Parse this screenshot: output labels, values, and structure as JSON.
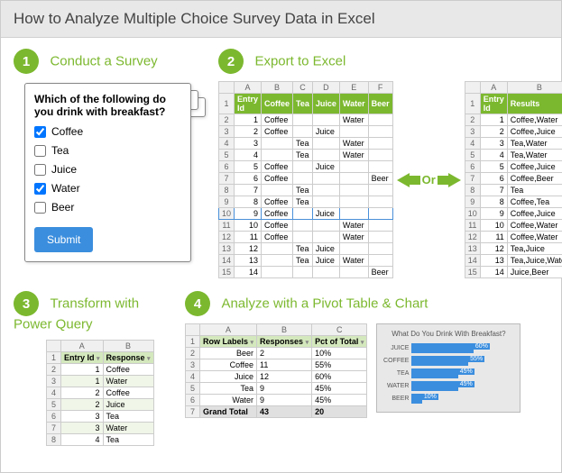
{
  "title": "How to Analyze Multiple Choice Survey Data in Excel",
  "steps": {
    "s1": {
      "num": "1",
      "title": "Conduct a Survey"
    },
    "s2": {
      "num": "2",
      "title": "Export to Excel"
    },
    "s3": {
      "num": "3",
      "title": "Transform with Power Query"
    },
    "s4": {
      "num": "4",
      "title": "Analyze with a Pivot Table & Chart"
    }
  },
  "survey": {
    "question": "Which of the following do you drink with breakfast?",
    "options": [
      "Coffee",
      "Tea",
      "Juice",
      "Water",
      "Beer"
    ],
    "checked": [
      true,
      false,
      false,
      true,
      false
    ],
    "submit": "Submit"
  },
  "or_label": "Or",
  "sheet_wide": {
    "cols": [
      "A",
      "B",
      "C",
      "D",
      "E",
      "F"
    ],
    "headers": [
      "Entry Id",
      "Coffee",
      "Tea",
      "Juice",
      "Water",
      "Beer"
    ],
    "rows": [
      [
        "1",
        "Coffee",
        "",
        "",
        "Water",
        ""
      ],
      [
        "2",
        "Coffee",
        "",
        "Juice",
        "",
        ""
      ],
      [
        "3",
        "",
        "Tea",
        "",
        "Water",
        ""
      ],
      [
        "4",
        "",
        "Tea",
        "",
        "Water",
        ""
      ],
      [
        "5",
        "Coffee",
        "",
        "Juice",
        "",
        ""
      ],
      [
        "6",
        "Coffee",
        "",
        "",
        "",
        "Beer"
      ],
      [
        "7",
        "",
        "Tea",
        "",
        "",
        ""
      ],
      [
        "8",
        "Coffee",
        "Tea",
        "",
        "",
        ""
      ],
      [
        "9",
        "Coffee",
        "",
        "Juice",
        "",
        ""
      ],
      [
        "10",
        "Coffee",
        "",
        "",
        "Water",
        ""
      ],
      [
        "11",
        "Coffee",
        "",
        "",
        "Water",
        ""
      ],
      [
        "12",
        "",
        "Tea",
        "Juice",
        "",
        ""
      ],
      [
        "13",
        "",
        "Tea",
        "Juice",
        "Water",
        ""
      ],
      [
        "14",
        "",
        "",
        "",
        "",
        "Beer"
      ]
    ]
  },
  "sheet_long": {
    "cols": [
      "A",
      "B"
    ],
    "headers": [
      "Entry Id",
      "Results"
    ],
    "rows": [
      [
        "1",
        "Coffee,Water"
      ],
      [
        "2",
        "Coffee,Juice"
      ],
      [
        "3",
        "Tea,Water"
      ],
      [
        "4",
        "Tea,Water"
      ],
      [
        "5",
        "Coffee,Juice"
      ],
      [
        "6",
        "Coffee,Beer"
      ],
      [
        "7",
        "Tea"
      ],
      [
        "8",
        "Coffee,Tea"
      ],
      [
        "9",
        "Coffee,Juice"
      ],
      [
        "10",
        "Coffee,Water"
      ],
      [
        "11",
        "Coffee,Water"
      ],
      [
        "12",
        "Tea,Juice"
      ],
      [
        "13",
        "Tea,Juice,Water"
      ],
      [
        "14",
        "Juice,Beer"
      ]
    ]
  },
  "pq": {
    "cols": [
      "A",
      "B"
    ],
    "headers": [
      "Entry Id",
      "Response"
    ],
    "rows": [
      [
        "1",
        "Coffee"
      ],
      [
        "1",
        "Water"
      ],
      [
        "2",
        "Coffee"
      ],
      [
        "2",
        "Juice"
      ],
      [
        "3",
        "Tea"
      ],
      [
        "3",
        "Water"
      ],
      [
        "4",
        "Tea"
      ]
    ]
  },
  "pivot": {
    "cols": [
      "A",
      "B",
      "C"
    ],
    "headers": [
      "Row Labels",
      "Responses",
      "Pct of Total"
    ],
    "rows": [
      [
        "Beer",
        "2",
        "10%"
      ],
      [
        "Coffee",
        "11",
        "55%"
      ],
      [
        "Juice",
        "12",
        "60%"
      ],
      [
        "Tea",
        "9",
        "45%"
      ],
      [
        "Water",
        "9",
        "45%"
      ]
    ],
    "total": [
      "Grand Total",
      "43",
      "20"
    ]
  },
  "chart_data": {
    "type": "bar",
    "title": "What Do You Drink With Breakfast?",
    "categories": [
      "JUICE",
      "COFFEE",
      "TEA",
      "WATER",
      "BEER"
    ],
    "values": [
      60,
      55,
      45,
      45,
      10
    ],
    "xlabel": "",
    "ylabel": "",
    "ylim": [
      0,
      100
    ]
  }
}
